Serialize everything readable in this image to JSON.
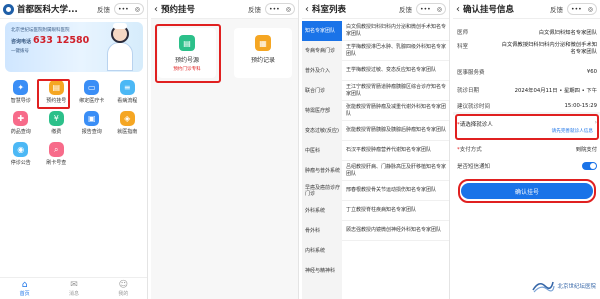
{
  "colors": {
    "primary": "#1a73e8",
    "highlight": "#e02020",
    "bannerPhone": "#d0202a"
  },
  "panel1": {
    "title": "首都医科大学...",
    "feedback": "反馈",
    "capsule": {
      "more": "•••",
      "close": "◎"
    },
    "banner": {
      "line1": "北京世纪坛医院附属眼科医院",
      "phone_prefix": "咨询电话",
      "phone": "633 12580",
      "line3": "一键拨号"
    },
    "grid": [
      {
        "label": "智慧导诊",
        "icon": "compass-icon",
        "color": "#3a8ef6",
        "glyph": "✦"
      },
      {
        "label": "预约挂号",
        "icon": "calendar-icon",
        "color": "#f5a623",
        "glyph": "▤"
      },
      {
        "label": "绑定医疗卡",
        "icon": "card-icon",
        "color": "#3a8ef6",
        "glyph": "▭"
      },
      {
        "label": "看病流程",
        "icon": "flow-icon",
        "color": "#4cb8f5",
        "glyph": "≡"
      },
      {
        "label": "药品查询",
        "icon": "pill-icon",
        "color": "#f76b8a",
        "glyph": "✚"
      },
      {
        "label": "缴费",
        "icon": "wallet-icon",
        "color": "#2cc08a",
        "glyph": "¥"
      },
      {
        "label": "报告查询",
        "icon": "report-icon",
        "color": "#3a8ef6",
        "glyph": "▣"
      },
      {
        "label": "就医指南",
        "icon": "guide-icon",
        "color": "#f5a623",
        "glyph": "◈"
      },
      {
        "label": "停诊公告",
        "icon": "notice-icon",
        "color": "#4cb8f5",
        "glyph": "◉"
      },
      {
        "label": "刷卡号查",
        "icon": "search-icon",
        "color": "#f76b8a",
        "glyph": "⌕"
      }
    ],
    "tabs": [
      {
        "label": "首页",
        "icon": "home-icon",
        "glyph": "⌂"
      },
      {
        "label": "消息",
        "icon": "message-icon",
        "glyph": "✉"
      },
      {
        "label": "我的",
        "icon": "user-icon",
        "glyph": "☺"
      }
    ]
  },
  "panel2": {
    "title": "预约挂号",
    "feedback": "反馈",
    "cards": [
      {
        "title": "预约号源",
        "subtitle": "预约门诊专科",
        "icon": "calendar-icon",
        "color": "#2cc08a",
        "glyph": "▤"
      },
      {
        "title": "预约记录",
        "subtitle": "",
        "icon": "record-icon",
        "color": "#f5a623",
        "glyph": "▦"
      }
    ]
  },
  "panel3": {
    "title": "科室列表",
    "feedback": "反馈",
    "left": [
      "知名专家团队",
      "专病专病门诊",
      "普外及介入",
      "联合门诊",
      "特需医疗部",
      "变态过敏(反应)",
      "中医科",
      "肿瘤与普外系统",
      "早癌及癌前诊疗门诊",
      "外科系统",
      "骨外科",
      "内科系统",
      "神经与精神科"
    ],
    "right": [
      "白文佩教授妇科妇科内分泌和微创手术知名专家团队",
      "王学梅教授淋巴水肿、乳腺四级外科知名专家团队",
      "王学梅教授过敏、变态反应知名专家团队",
      "王江宁教授胃肠道肿瘤胰腺区综合诊疗知名专家团队",
      "张能教授胃肠肿瘤及减重代谢外科知名专家团队",
      "张能教授胃肠胰腺及胰腺后肿瘤知名专家团队",
      "石汉平教授肿瘤营养代谢知名专家团队",
      "吕绍教授肝病、门静脉高压及肝移植知名专家团队",
      "邢春根教授骨关节运动损伤知名专家团队",
      "丁立教授脊柱疾病知名专家团队",
      "顾志强教授内镜微创神经外科知名专家团队"
    ]
  },
  "panel4": {
    "title": "确认挂号信息",
    "feedback": "反馈",
    "rows": [
      {
        "label": "医师",
        "value": "白文佩妇科知名专家团队"
      },
      {
        "label": "科室",
        "value": "白文佩教授妇科妇科内分泌和微创手术知名专家团队"
      },
      {
        "label": "医事服务费",
        "value": "¥60"
      },
      {
        "label": "就诊日期",
        "value": "2024年04月11日 • 星期四 • 下午"
      },
      {
        "label": "建议就诊时间",
        "value": "15:00-15:29"
      }
    ],
    "patient": {
      "label": "请选择就诊人",
      "link": "请先完善就诊人信息"
    },
    "pay": {
      "label": "支付方式",
      "value": "到院支付"
    },
    "notify": {
      "label": "是否短信通知"
    },
    "confirm": "确认挂号"
  },
  "watermark": "北京世纪坛医院"
}
